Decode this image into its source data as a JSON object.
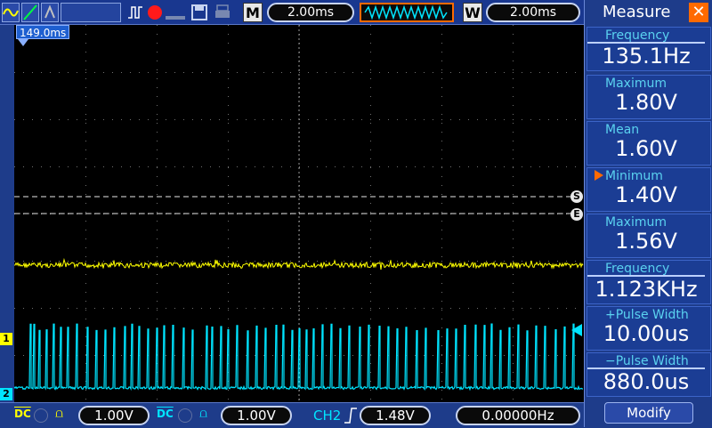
{
  "toolbar": {
    "memory_label": "M",
    "memory_time": "2.00ms",
    "window_label": "W",
    "window_time": "2.00ms"
  },
  "screen": {
    "time_position": "149.0ms",
    "marker_start": "S",
    "marker_end": "E",
    "ch1_marker": "1",
    "ch2_marker": "2"
  },
  "bottom": {
    "ch1_coupling": "DC",
    "ch1_scale": "1.00V",
    "ch2_coupling": "DC",
    "ch2_scale": "1.00V",
    "trigger_channel": "CH2",
    "trigger_level": "1.48V",
    "frequency": "0.00000Hz"
  },
  "measure": {
    "title": "Measure",
    "items": [
      {
        "label": "Frequency",
        "value": "135.1Hz"
      },
      {
        "label": "Maximum",
        "value": "1.80V"
      },
      {
        "label": "Mean",
        "value": "1.60V"
      },
      {
        "label": "Minimum",
        "value": "1.40V"
      },
      {
        "label": "Maximum",
        "value": "1.56V"
      },
      {
        "label": "Frequency",
        "value": "1.123KHz"
      },
      {
        "label": "+Pulse Width",
        "value": "10.00us"
      },
      {
        "label": "−Pulse Width",
        "value": "880.0us"
      }
    ],
    "modify_label": "Modify"
  },
  "colors": {
    "ch1": "#ffff00",
    "ch2": "#00e5ff",
    "accent": "#ff6a00",
    "panel_bg": "#1e3c8a"
  }
}
